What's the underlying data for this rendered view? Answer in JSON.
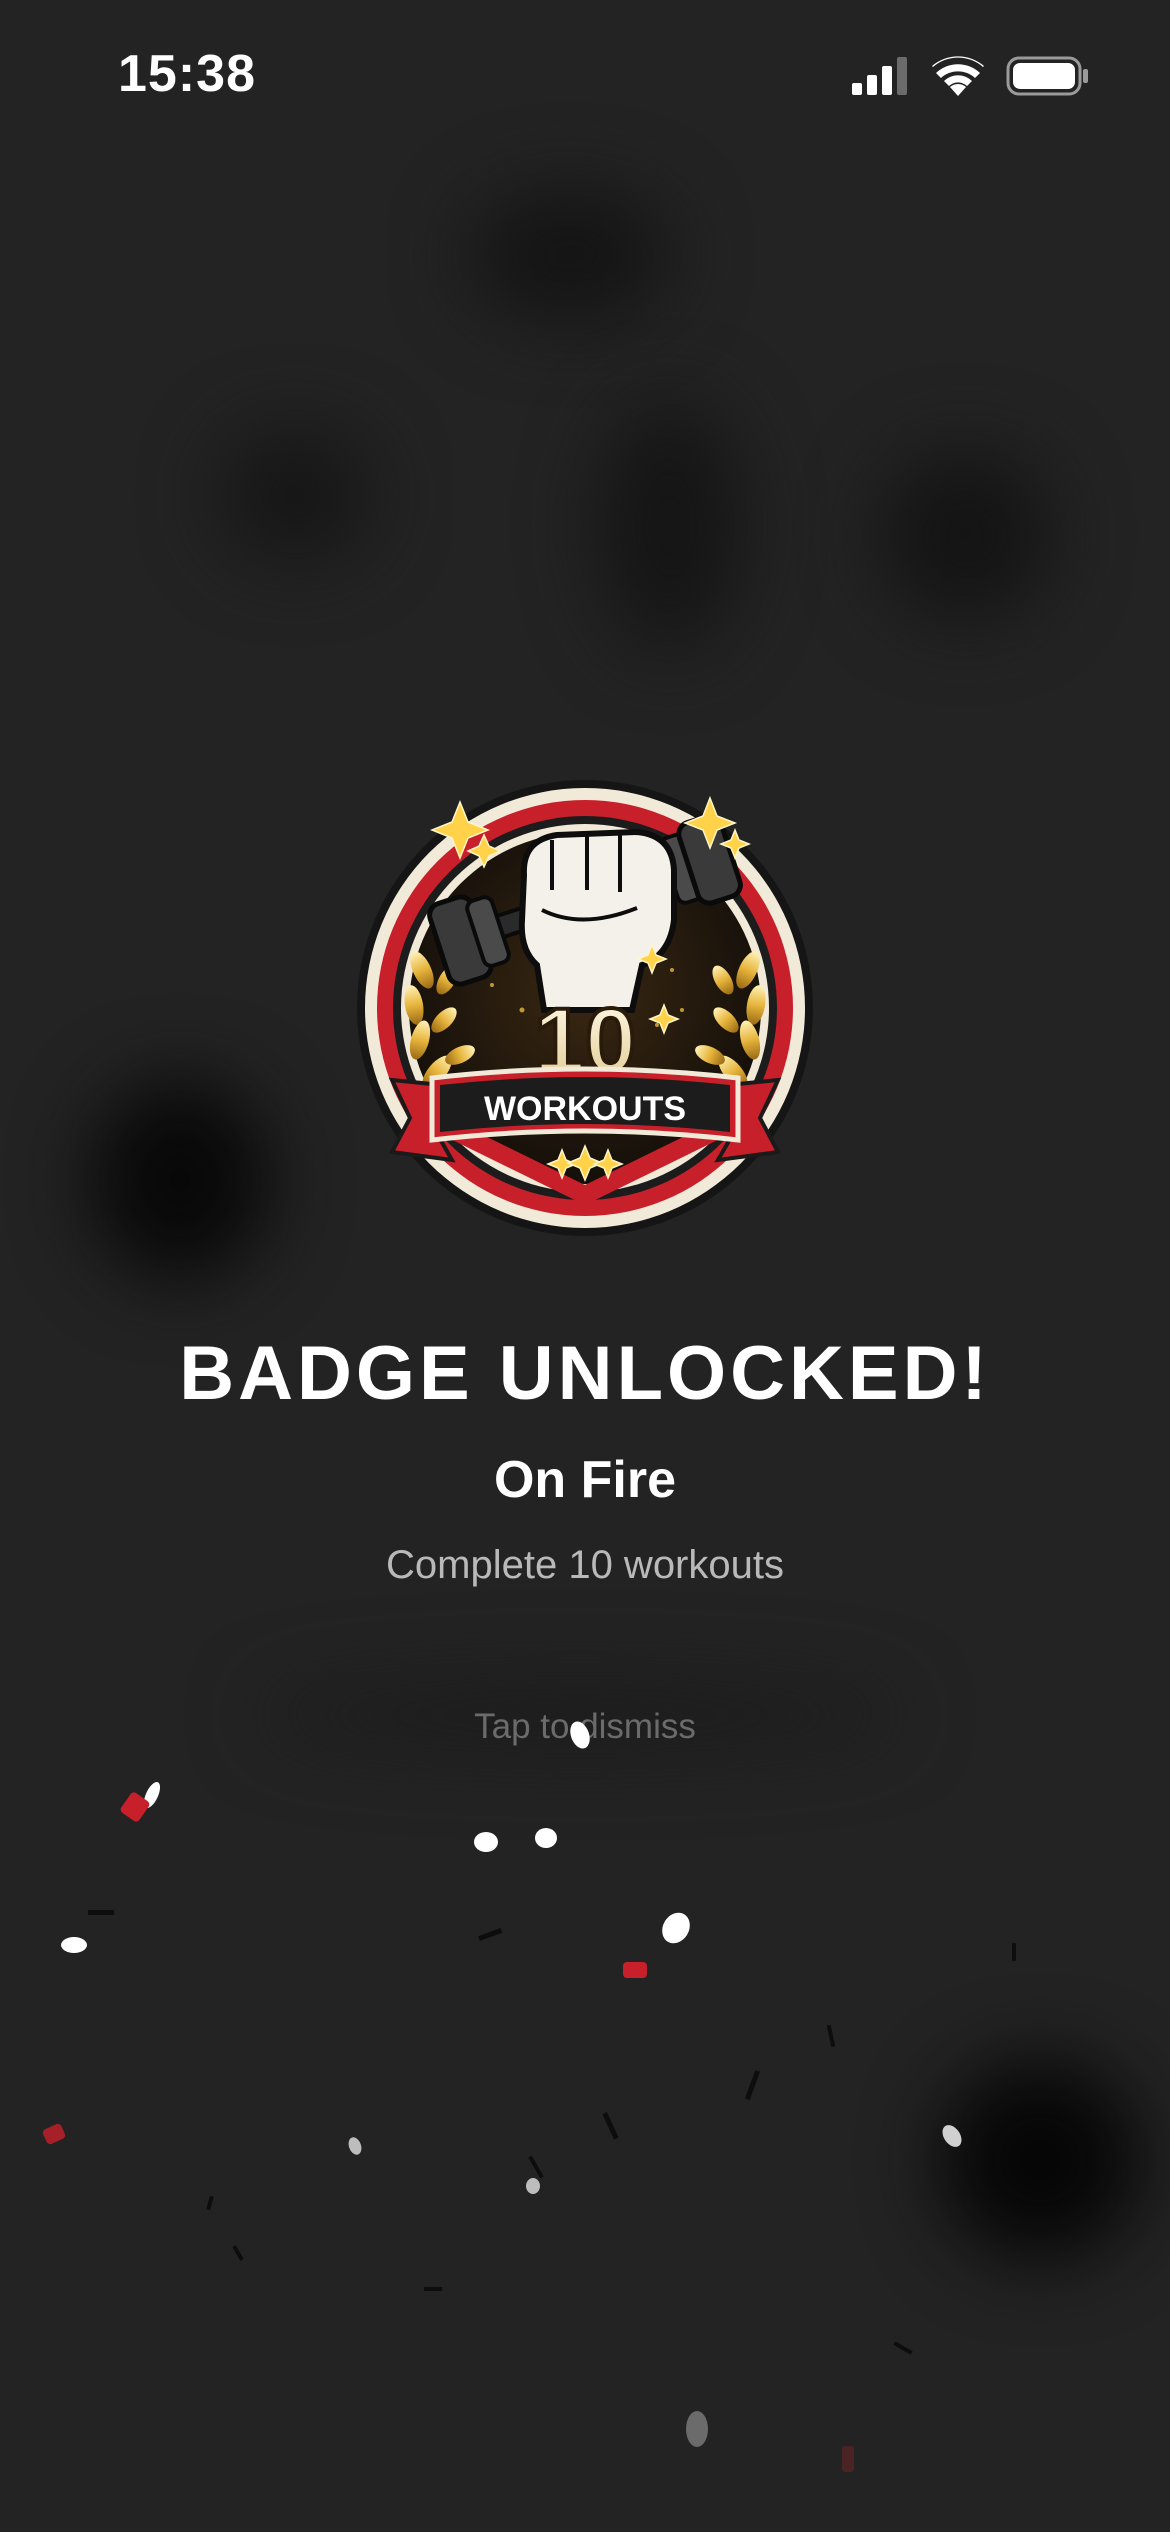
{
  "status_bar": {
    "time": "15:38",
    "icons": [
      "cellular-signal-icon",
      "wifi-icon",
      "battery-icon"
    ]
  },
  "badge": {
    "icon": "dumbbell-fist-badge",
    "number": "10",
    "ribbon_text": "WORKOUTS",
    "colors": {
      "red": "#c8202a",
      "gold": "#e7b53c",
      "cream": "#f2ead8",
      "dark": "#1c1c1c"
    }
  },
  "celebration": {
    "title": "BADGE UNLOCKED!",
    "badge_name": "On Fire",
    "badge_description": "Complete 10 workouts",
    "dismiss_hint": "Tap to dismiss"
  },
  "theme": {
    "background": "#232323",
    "confetti_colors": [
      "#ffffff",
      "#c8202a",
      "#0d0d0d",
      "#bdbdbd"
    ]
  }
}
